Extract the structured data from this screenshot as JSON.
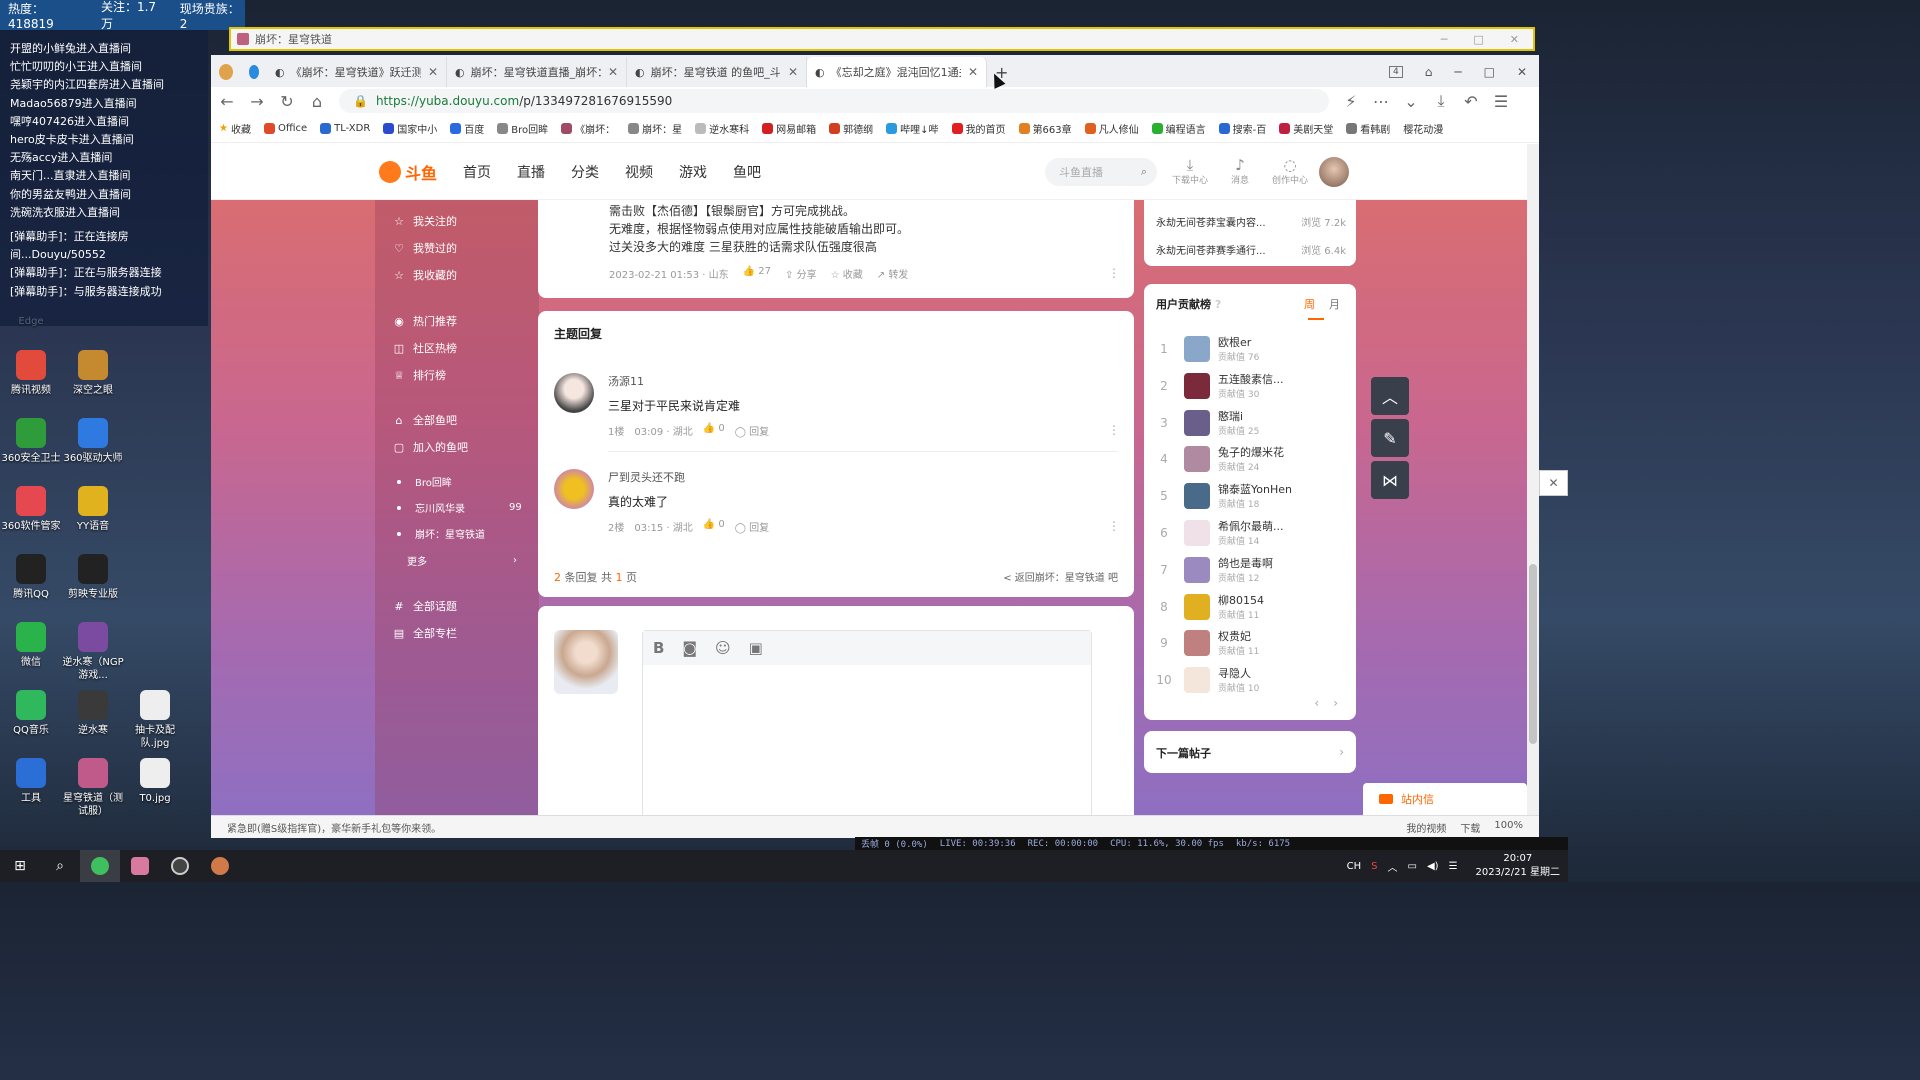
{
  "overlay": {
    "heat": "热度：418819",
    "follow": "关注：1.7万",
    "nobles": "现场贵族：2",
    "danmu": [
      "开盟的小鲜兔进入直播间",
      "忙忙叨叨的小王进入直播间",
      "尧颖宇的内江四套房进入直播间",
      "Madao56879进入直播间",
      "嘿哼407426进入直播间",
      "hero皮卡皮卡进入直播间",
      "无殇accy进入直播间",
      "南天门...直隶进入直播间",
      "你的男盆友鸭进入直播间",
      "洗碗洗衣服进入直播间"
    ],
    "system": [
      "[弹幕助手]：正在连接房间...Douyu/50552",
      "[弹幕助手]：正在与服务器连接",
      "[弹幕助手]：与服务器连接成功"
    ]
  },
  "desktop": {
    "icons": [
      "腾讯视频",
      "深空之眼",
      "360安全卫士",
      "360驱动大师",
      "360软件管家",
      "YY语音",
      "腾讯QQ",
      "剪映专业版",
      "微信",
      "逆水寒（NGP游戏...",
      "QQ音乐",
      "逆水寒",
      "抽卡及配队.jpg",
      "工具",
      "星穹铁道（测试服）",
      "T0.jpg"
    ],
    "edge_label": "Edge",
    "colors": [
      "#e24a3b",
      "#c58a2f",
      "#2e9c3a",
      "#2e7ae0",
      "#e6484f",
      "#e0b21e",
      "#222222",
      "#222222",
      "#2ab34a",
      "#7a4ba0",
      "#2fb85c",
      "#3a3a3a",
      "#eeeeee",
      "#2a6ed6",
      "#c05a8a",
      "#eeeeee"
    ]
  },
  "stream_window": {
    "title": "崩坏：星穹铁道"
  },
  "browser": {
    "tab_count": "4",
    "tabs": [
      {
        "title": "《崩坏：星穹铁道》跃迁测试"
      },
      {
        "title": "崩坏：星穹铁道直播_崩坏：星"
      },
      {
        "title": "崩坏：星穹铁道 的鱼吧_斗鱼"
      },
      {
        "title": "《忘却之庭》混沌回忆1通关"
      }
    ],
    "url_host": "https://yuba.douyu.com",
    "url_path": "/p/133497281676915590",
    "bookmarks": [
      "收藏",
      "Office",
      "TL-XDR",
      "国家中小",
      "百度",
      "Bro回眸",
      "《崩坏：",
      "崩坏：星",
      "逆水寒科",
      "网易邮箱",
      "郭德纲",
      "哔哩↓哔",
      "我的首页",
      "第663章",
      "凡人修仙",
      "编程语言",
      "搜索-百",
      "美剧天堂",
      "看韩剧",
      "樱花动漫"
    ]
  },
  "site": {
    "logo": "斗鱼",
    "nav": [
      "首页",
      "直播",
      "分类",
      "视频",
      "游戏",
      "鱼吧"
    ],
    "search_placeholder": "斗鱼直播",
    "header_icons": [
      "下载中心",
      "消息",
      "创作中心"
    ]
  },
  "leftnav": {
    "items": [
      "我关注的",
      "我赞过的",
      "我收藏的",
      "热门推荐",
      "社区热榜",
      "排行榜",
      "全部鱼吧",
      "加入的鱼吧"
    ],
    "joined": [
      "Bro回眸",
      "忘川风华录",
      "崩坏：星穹铁道",
      "更多"
    ],
    "badge": "99",
    "bottom": [
      "全部话题",
      "全部专栏"
    ]
  },
  "post": {
    "lines": [
      "需击败【杰佰德】【银鬃厨官】方可完成挑战。",
      "无难度，根据怪物弱点使用对应属性技能破盾输出即可。",
      "过关没多大的难度 三星获胜的话需求队伍强度很高"
    ],
    "time": "2023-02-21 01:53 · 山东",
    "likes": "27",
    "share": "分享",
    "favorite": "收藏",
    "forward": "转发"
  },
  "replies": {
    "heading": "主题回复",
    "items": [
      {
        "name": "汤源11",
        "text": "三星对于平民来说肯定难",
        "floor": "1楼",
        "time": "03:09 · 湖北",
        "likes": "0",
        "reply": "回复"
      },
      {
        "name": "尸到灵头还不跑",
        "text": "真的太难了",
        "floor": "2楼",
        "time": "03:15 · 湖北",
        "likes": "0",
        "reply": "回复"
      }
    ],
    "count": "2",
    "pages": "1",
    "count_prefix": "",
    "count_mid": "条回复 共",
    "count_suffix": "页",
    "back": "< 返回崩坏：星穹铁道 吧"
  },
  "right": {
    "hot": [
      {
        "title": "永劫无间苍莽宝囊内容...",
        "views": "浏览 7.2k"
      },
      {
        "title": "永劫无间苍莽赛季通行...",
        "views": "浏览 6.4k"
      }
    ],
    "rank_title": "用户贡献榜",
    "tab_week": "周",
    "tab_month": "月",
    "ranks": [
      {
        "n": "1",
        "name": "欧根er",
        "score": "贡献值 76"
      },
      {
        "n": "2",
        "name": "五连酸素信...",
        "score": "贡献值 30"
      },
      {
        "n": "3",
        "name": "憨瑞i",
        "score": "贡献值 25"
      },
      {
        "n": "4",
        "name": "兔子的爆米花",
        "score": "贡献值 24"
      },
      {
        "n": "5",
        "name": "锦泰蓝YonHen",
        "score": "贡献值 18"
      },
      {
        "n": "6",
        "name": "希佩尔最萌...",
        "score": "贡献值 14"
      },
      {
        "n": "7",
        "name": "鸽也是毒啊",
        "score": "贡献值 12"
      },
      {
        "n": "8",
        "name": "柳80154",
        "score": "贡献值 11"
      },
      {
        "n": "9",
        "name": "权贵妃",
        "score": "贡献值 11"
      },
      {
        "n": "10",
        "name": "寻隐人",
        "score": "贡献值 10"
      }
    ],
    "rank_colors": [
      "#8aa7c9",
      "#7a2a3a",
      "#6a5f8a",
      "#b08aa0",
      "#4a6a8a",
      "#f0e0e8",
      "#9a8ac0",
      "#e0b020",
      "#c08080",
      "#f4e6da"
    ],
    "next_post": "下一篇帖子",
    "inbox": "站内信"
  },
  "statusbar": {
    "tip": "紧急即(赠S级指挥官)，豪华新手礼包等你来领。",
    "items": [
      "我的视频",
      "下载",
      "100%"
    ]
  },
  "obs": {
    "drop": "丢帧 0 (0.0%)",
    "live": "LIVE: 00:39:36",
    "rec": "REC: 00:00:00",
    "cpu": "CPU: 11.6%, 30.00 fps",
    "kbps": "kb/s: 6175"
  },
  "taskbar": {
    "ime": "CH",
    "time": "20:07",
    "date": "2023/2/21 星期二"
  }
}
